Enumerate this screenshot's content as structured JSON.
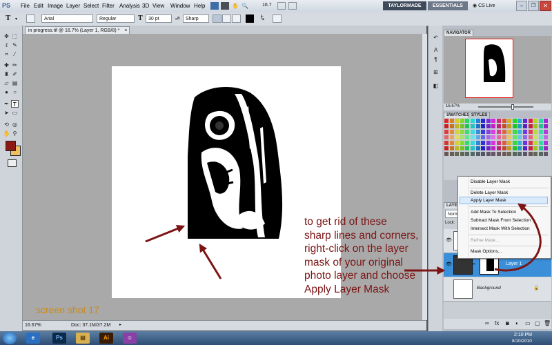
{
  "menubar": {
    "app_logo": "PS",
    "items": [
      "File",
      "Edit",
      "Image",
      "Layer",
      "Select",
      "Filter",
      "Analysis",
      "3D",
      "View",
      "Window",
      "Help"
    ],
    "zoom_value": "16.7",
    "workspace_active": "TAYLORMADE",
    "workspace_other": "ESSENTIALS",
    "cs_live": "CS Live"
  },
  "options": {
    "tool_glyph": "T",
    "font_family": "Arial",
    "font_style": "Regular",
    "font_size": "30 pt",
    "anti_alias": "Sharp"
  },
  "document": {
    "tab_title": "in progress.tif @ 16.7% (Layer 1, RGB/8) *",
    "zoom": "16.67%",
    "doc_info": "Doc: 37.1M/37.2M"
  },
  "navigator": {
    "tab": "NAVIGATOR",
    "zoom": "16.67%"
  },
  "swatches": {
    "tab_swatches": "SWATCHES",
    "tab_styles": "STYLES"
  },
  "layers": {
    "tab": "LAYERS",
    "blend_mode": "Normal",
    "lock_label": "Lock:",
    "layer1_name": "Layer 1",
    "background_name": "Background"
  },
  "context_menu": {
    "items": [
      {
        "label": "Disable Layer Mask",
        "enabled": true
      },
      {
        "label": "Delete Layer Mask",
        "enabled": true
      },
      {
        "label": "Apply Layer Mask",
        "enabled": true,
        "highlighted": true
      },
      {
        "label": "Add Mask To Selection",
        "enabled": true
      },
      {
        "label": "Subtract Mask From Selection",
        "enabled": true
      },
      {
        "label": "Intersect Mask With Selection",
        "enabled": true
      },
      {
        "label": "Refine Mask...",
        "enabled": false
      },
      {
        "label": "Mask Options...",
        "enabled": true
      }
    ]
  },
  "annotation": {
    "lines": [
      "to get rid of these",
      "sharp lines and corners,",
      "right-click on the layer",
      "mask of your original",
      "photo layer and choose",
      "Apply Layer Mask"
    ],
    "label": "screen shot 17",
    "color": "#7c1414"
  },
  "taskbar": {
    "time": "2:10 PM",
    "date": "8/10/2010",
    "apps": [
      "start-orb",
      "ie",
      "photoshop",
      "explorer",
      "illustrator",
      "messenger"
    ]
  },
  "colors": {
    "foreground": "#8b1a14",
    "background": "#f0c060",
    "accent": "#3b8fd9"
  }
}
